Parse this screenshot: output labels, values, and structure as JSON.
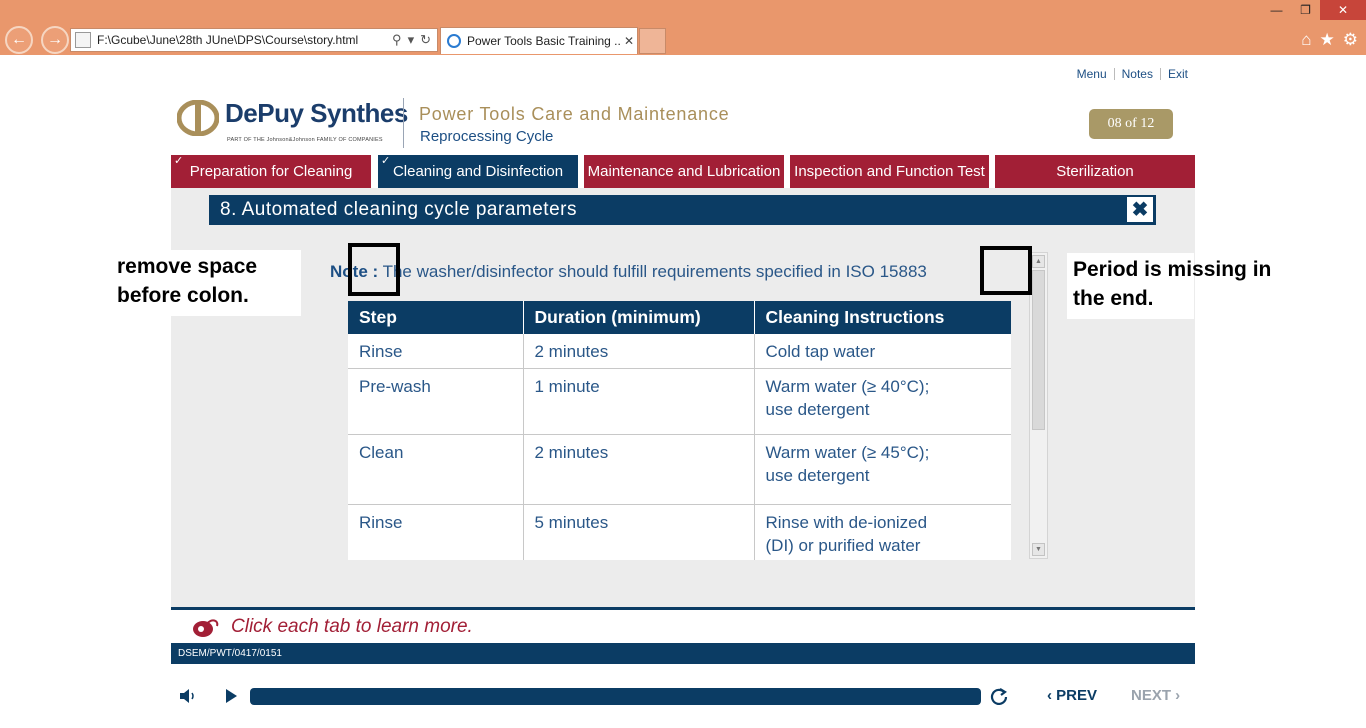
{
  "browser": {
    "url": "F:\\Gcube\\June\\28th JUne\\DPS\\Course\\story.html",
    "tab_title": "Power Tools Basic Training ...",
    "icons": [
      "back-icon",
      "forward-icon",
      "search-icon",
      "refresh-icon",
      "home-icon",
      "favorites-icon",
      "settings-icon"
    ]
  },
  "toplinks": {
    "menu": "Menu",
    "notes": "Notes",
    "exit": "Exit"
  },
  "header": {
    "logo_text": "DePuy Synthes",
    "logo_sub": "PART OF THE Johnson&Johnson FAMILY OF COMPANIES",
    "course_title": "Power Tools Care and Maintenance",
    "course_subtitle": "Reprocessing Cycle",
    "page_indicator": "08 of 12"
  },
  "tabs": [
    {
      "label": "Preparation for Cleaning",
      "visited": true,
      "active": false
    },
    {
      "label": "Cleaning and Disinfection",
      "visited": true,
      "active": true
    },
    {
      "label": "Maintenance and Lubrication",
      "visited": false,
      "active": false
    },
    {
      "label": "Inspection and Function Test",
      "visited": false,
      "active": false
    },
    {
      "label": "Sterilization",
      "visited": false,
      "active": false
    }
  ],
  "slide": {
    "title": "8. Automated cleaning cycle parameters",
    "close_label": "✖",
    "note_label": "Note :",
    "note_text": " The washer/disinfector should fulfill requirements specified in ISO 15883"
  },
  "table": {
    "headers": [
      "Step",
      "Duration (minimum)",
      "Cleaning Instructions"
    ],
    "rows": [
      [
        "Rinse",
        "2 minutes",
        "Cold tap water"
      ],
      [
        "Pre-wash",
        "1 minute",
        "Warm water (≥ 40°C);",
        "use detergent"
      ],
      [
        "Clean",
        "2 minutes",
        "Warm water (≥ 45°C);",
        "use detergent"
      ],
      [
        "Rinse",
        "5 minutes",
        "Rinse with de-ionized",
        "(DI) or purified water"
      ]
    ]
  },
  "annotations": {
    "left_line1": "remove space",
    "left_line2": "before colon.",
    "right_line1": "Period is missing in",
    "right_line2": "the end."
  },
  "footer": {
    "hint": "Click each tab to learn more.",
    "code": "DSEM/PWT/0417/0151"
  },
  "player": {
    "prev": "PREV",
    "next": "NEXT",
    "progress": 1.0
  },
  "colors": {
    "chrome": "#e9976c",
    "navy": "#0b3c64",
    "crimson": "#a21f36",
    "gold": "#a99967"
  }
}
